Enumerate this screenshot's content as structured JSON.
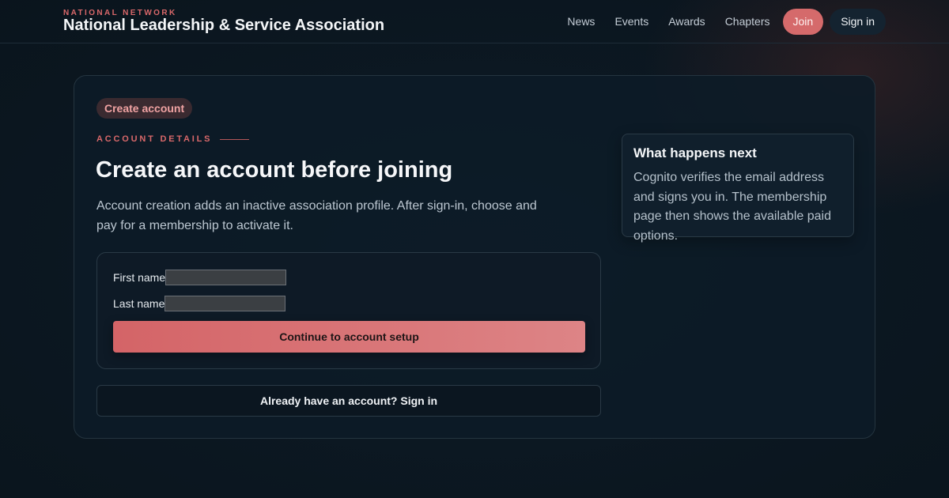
{
  "header": {
    "kicker": "NATIONAL NETWORK",
    "title": "National Leadership & Service Association",
    "nav": [
      "News",
      "Events",
      "Awards",
      "Chapters"
    ],
    "join_label": "Join",
    "signin_label": "Sign in"
  },
  "main": {
    "badge": "Create account",
    "eyebrow": "ACCOUNT DETAILS",
    "heading": "Create an account before joining",
    "description": "Account creation adds an inactive association profile. After sign-in, choose and pay for a membership to activate it.",
    "form": {
      "first_name_label": "First name",
      "first_name_value": "",
      "last_name_label": "Last name",
      "last_name_value": "",
      "continue_label": "Continue to account setup"
    },
    "already_label": "Already have an account? Sign in"
  },
  "aside": {
    "title": "What happens next",
    "text": "Cognito verifies the email address and signs you in. The membership page then shows the available paid options."
  },
  "colors": {
    "accent": "#d56a6b",
    "background": "#0b1620",
    "card": "#0d1b27"
  }
}
